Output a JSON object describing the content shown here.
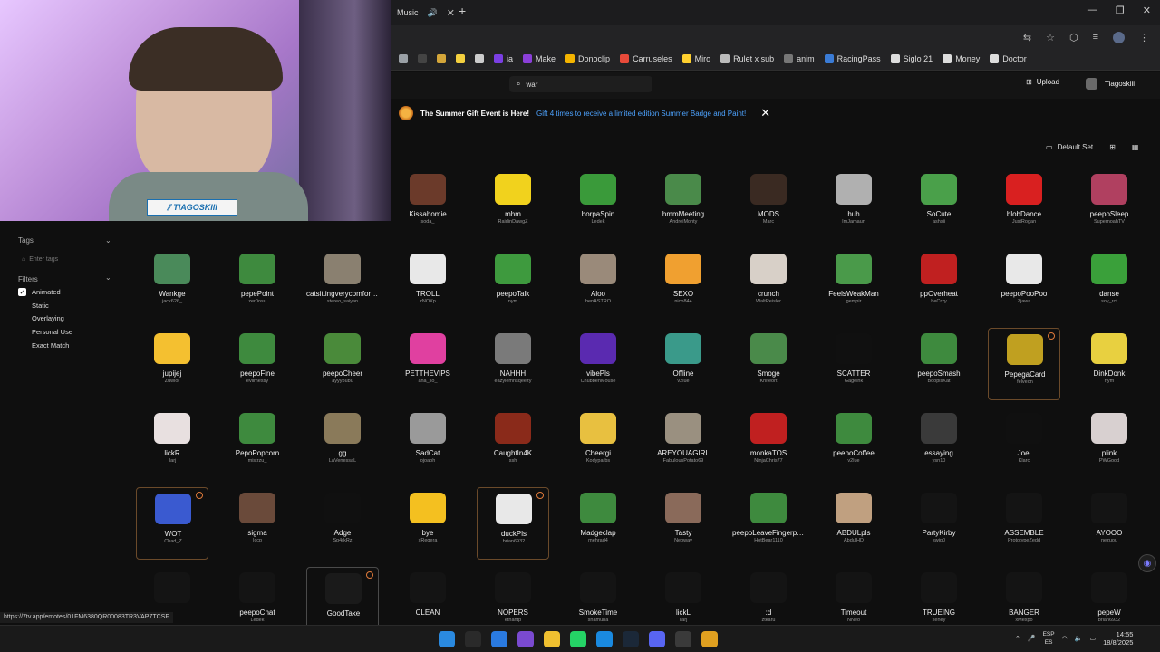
{
  "browser": {
    "tab_title": "Music",
    "bookmarks": [
      {
        "label": "",
        "icon": "settings-icon",
        "color": "#9aa0a6"
      },
      {
        "label": "",
        "icon": "terminal-icon",
        "color": "#444"
      },
      {
        "label": "",
        "icon": "grid-icon",
        "color": "#d4a63a"
      },
      {
        "label": "",
        "icon": "bold-b-icon",
        "color": "#f4d03f"
      },
      {
        "label": "",
        "icon": "infinity-icon",
        "color": "#cccccc"
      },
      {
        "label": "ia",
        "icon": "ia-icon",
        "color": "#7b3fe4"
      },
      {
        "label": "Make",
        "icon": "make-icon",
        "color": "#8b3fd9"
      },
      {
        "label": "Donoclip",
        "icon": "donoclip-icon",
        "color": "#f4b400"
      },
      {
        "label": "Carruseles",
        "icon": "carruseles-icon",
        "color": "#e84a3a"
      },
      {
        "label": "Miro",
        "icon": "miro-icon",
        "color": "#ffd02f"
      },
      {
        "label": "Rulet x sub",
        "icon": "roulette-icon",
        "color": "#bbbbbb"
      },
      {
        "label": "anim",
        "icon": "anim-icon",
        "color": "#777777"
      },
      {
        "label": "RacingPass",
        "icon": "racingpass-icon",
        "color": "#3a7bd5"
      },
      {
        "label": "Siglo 21",
        "icon": "folder-icon",
        "color": "#dddddd"
      },
      {
        "label": "Money",
        "icon": "folder-icon",
        "color": "#dddddd"
      },
      {
        "label": "Doctor",
        "icon": "folder-icon",
        "color": "#dddddd"
      }
    ]
  },
  "header": {
    "search_value": "war",
    "upload_label": "Upload",
    "username": "Tiagoskiii"
  },
  "banner": {
    "title": "The Summer Gift Event is Here!",
    "link_text": "Gift 4 times to receive a limited edition Summer Badge and Paint!"
  },
  "view": {
    "set_label": "Default Set"
  },
  "sidebar": {
    "tags_label": "Tags",
    "tags_placeholder": "Enter tags",
    "filters_label": "Filters",
    "filters": [
      {
        "label": "Animated",
        "checked": true
      },
      {
        "label": "Static",
        "checked": false
      },
      {
        "label": "Overlaying",
        "checked": false
      },
      {
        "label": "Personal Use",
        "checked": false
      },
      {
        "label": "Exact Match",
        "checked": false
      }
    ]
  },
  "webcam": {
    "logo_text": "TIAGOSKIII"
  },
  "emote_rows": [
    [
      {
        "name": "Kissahomie",
        "owner": "soda_",
        "color": "#6b3a2a"
      },
      {
        "name": "mhm",
        "owner": "RaidinDawgZ",
        "color": "#f1d21d"
      },
      {
        "name": "borpaSpin",
        "owner": "Ledek",
        "color": "#3a9a3a"
      },
      {
        "name": "hmmMeeting",
        "owner": "AndreiMonty",
        "color": "#4a8a4a"
      },
      {
        "name": "MODS",
        "owner": "Marc",
        "color": "#3a2a22"
      },
      {
        "name": "huh",
        "owner": "ImJamaun",
        "color": "#b0b0b0"
      },
      {
        "name": "SoCute",
        "owner": "ashsii",
        "color": "#4aa04a"
      },
      {
        "name": "blobDance",
        "owner": "JustRogan",
        "color": "#d92020"
      },
      {
        "name": "peepoSleep",
        "owner": "SupernoahTV",
        "color": "#b04060"
      }
    ],
    [
      {
        "name": "Wankge",
        "owner": "jack626_",
        "color": "#4a8a5a"
      },
      {
        "name": "pepePoint",
        "owner": "zer0osu",
        "color": "#3e8a3e"
      },
      {
        "name": "catsittingverycomfortable",
        "owner": "stereo_saiyan",
        "color": "#8a8070"
      },
      {
        "name": "TROLL",
        "owner": "zNOXp",
        "color": "#e8e8e8"
      },
      {
        "name": "peepoTalk",
        "owner": "nym",
        "color": "#3e9a3e"
      },
      {
        "name": "Aloo",
        "owner": "benASTRO",
        "color": "#9a8a7a"
      },
      {
        "name": "SEXO",
        "owner": "nico844",
        "color": "#f0a030"
      },
      {
        "name": "crunch",
        "owner": "WaltReisler",
        "color": "#d8d0c8"
      },
      {
        "name": "FeelsWeakMan",
        "owner": "gempir",
        "color": "#4a9a4a"
      },
      {
        "name": "ppOverheat",
        "owner": "heCrzy",
        "color": "#c02020"
      },
      {
        "name": "peepoPooPoo",
        "owner": "Zjawa",
        "color": "#e8e8e8"
      },
      {
        "name": "danse",
        "owner": "soy_rct",
        "color": "#3aa03a"
      }
    ],
    [
      {
        "name": "jupijej",
        "owner": "Zuwior",
        "color": "#f4c030"
      },
      {
        "name": "peepoFine",
        "owner": "evilmessy",
        "color": "#3e8a3e"
      },
      {
        "name": "peepoCheer",
        "owner": "ayyybubu",
        "color": "#4a8a3a"
      },
      {
        "name": "PETTHEVIPS",
        "owner": "ana_so_",
        "color": "#e040a0"
      },
      {
        "name": "NAHHH",
        "owner": "eazylemnsqeezy",
        "color": "#7a7a7a"
      },
      {
        "name": "vibePls",
        "owner": "ChubbehMouse",
        "color": "#5a2ab0"
      },
      {
        "name": "Offline",
        "owner": "v2lue",
        "color": "#3a9a8a"
      },
      {
        "name": "Smoge",
        "owner": "Kniteort",
        "color": "#4a8a4a"
      },
      {
        "name": "SCATTER",
        "owner": "Gageink",
        "color": "#101010"
      },
      {
        "name": "peepoSmash",
        "owner": "BoopisKat",
        "color": "#3e8a3e"
      },
      {
        "name": "PepegaCard",
        "owner": "felveon",
        "color": "#c0a020"
      },
      {
        "name": "DinkDonk",
        "owner": "nym",
        "color": "#e8d040"
      }
    ],
    [
      {
        "name": "lickR",
        "owner": "llarj",
        "color": "#e8e0e0"
      },
      {
        "name": "PepoPopcorn",
        "owner": "mistrzu_",
        "color": "#3e8a3e"
      },
      {
        "name": "gg",
        "owner": "LaVenessaL",
        "color": "#8a7a5a"
      },
      {
        "name": "SadCat",
        "owner": "ojoaoh",
        "color": "#9a9a9a"
      },
      {
        "name": "CaughtIn4K",
        "owner": "ssh",
        "color": "#8a2a1a"
      },
      {
        "name": "Cheergi",
        "owner": "Kodyparbs",
        "color": "#e8c040"
      },
      {
        "name": "AREYOUAGIRL",
        "owner": "FabulousPotato69",
        "color": "#9a9080"
      },
      {
        "name": "monkaTOS",
        "owner": "NinjaChris77",
        "color": "#c02020"
      },
      {
        "name": "peepoCoffee",
        "owner": "v2lue",
        "color": "#3e8a3e"
      },
      {
        "name": "essaying",
        "owner": "ysn10",
        "color": "#3a3a3a"
      },
      {
        "name": "Joel",
        "owner": "Klarc",
        "color": "#101010"
      },
      {
        "name": "plink",
        "owner": "PWGood",
        "color": "#d8d0d0"
      }
    ],
    [
      {
        "name": "WOT",
        "owner": "Chad_Z",
        "color": "#3a5ad0"
      },
      {
        "name": "sigma",
        "owner": "Iccp",
        "color": "#6a4a3a"
      },
      {
        "name": "Adge",
        "owner": "Sp4rkRz",
        "color": "#101010"
      },
      {
        "name": "bye",
        "owner": "xRegera",
        "color": "#f4c020"
      },
      {
        "name": "duckPls",
        "owner": "brian6932",
        "color": "#e8e8e8"
      },
      {
        "name": "Madgeclap",
        "owner": "mehrad4",
        "color": "#3e8a3e"
      },
      {
        "name": "Tasty",
        "owner": "Neowav",
        "color": "#8a6a5a"
      },
      {
        "name": "peepoLeaveFingerprints",
        "owner": "HotBear1110",
        "color": "#3e8a3e"
      },
      {
        "name": "ABDULpls",
        "owner": "AbdulHD",
        "color": "#c0a080"
      },
      {
        "name": "PartyKirby",
        "owner": "swig0",
        "color": "#141414"
      },
      {
        "name": "ASSEMBLE",
        "owner": "PrototypeZedd",
        "color": "#141414"
      },
      {
        "name": "AYOOO",
        "owner": "nezuou",
        "color": "#141414"
      }
    ],
    [
      {
        "name": "",
        "owner": "",
        "color": "#141414"
      },
      {
        "name": "peepoChat",
        "owner": "Ledek",
        "color": "#141414"
      },
      {
        "name": "GoodTake",
        "owner": "",
        "color": "#1a1a1a"
      },
      {
        "name": "CLEAN",
        "owner": "",
        "color": "#141414"
      },
      {
        "name": "NOPERS",
        "owner": "ethantp",
        "color": "#141414"
      },
      {
        "name": "SmokeTime",
        "owner": "shamuna",
        "color": "#141414"
      },
      {
        "name": "lickL",
        "owner": "llarj",
        "color": "#141414"
      },
      {
        "name": ":d",
        "owner": "ztkaru",
        "color": "#141414"
      },
      {
        "name": "Timeout",
        "owner": "NNeo",
        "color": "#141414"
      },
      {
        "name": "TRUEING",
        "owner": "xeney",
        "color": "#141414"
      },
      {
        "name": "BANGER",
        "owner": "xMexpo",
        "color": "#141414"
      },
      {
        "name": "pepeW",
        "owner": "brian6932",
        "color": "#141414"
      }
    ]
  ],
  "status_url": "https://7tv.app/emotes/01FM6380QR00083TR3VAP7TCSF",
  "taskbar": {
    "apps": [
      {
        "icon": "windows-start-icon",
        "color": "#2a8ae0"
      },
      {
        "icon": "search-icon",
        "color": "#2a2a2a"
      },
      {
        "icon": "notes-icon",
        "color": "#2a7ae0"
      },
      {
        "icon": "dragon-icon",
        "color": "#7a4ad0"
      },
      {
        "icon": "files-icon",
        "color": "#f0c030"
      },
      {
        "icon": "whatsapp-icon",
        "color": "#25d366"
      },
      {
        "icon": "edge-icon",
        "color": "#1a8ae0"
      },
      {
        "icon": "steam-icon",
        "color": "#1b2838"
      },
      {
        "icon": "discord-icon",
        "color": "#5865f2"
      },
      {
        "icon": "obs-icon",
        "color": "#3a3a3a"
      },
      {
        "icon": "chrome-icon",
        "color": "#e0a020"
      }
    ],
    "lang_top": "ESP",
    "lang_bottom": "ES",
    "time": "14:55",
    "date": "18/8/2025"
  }
}
